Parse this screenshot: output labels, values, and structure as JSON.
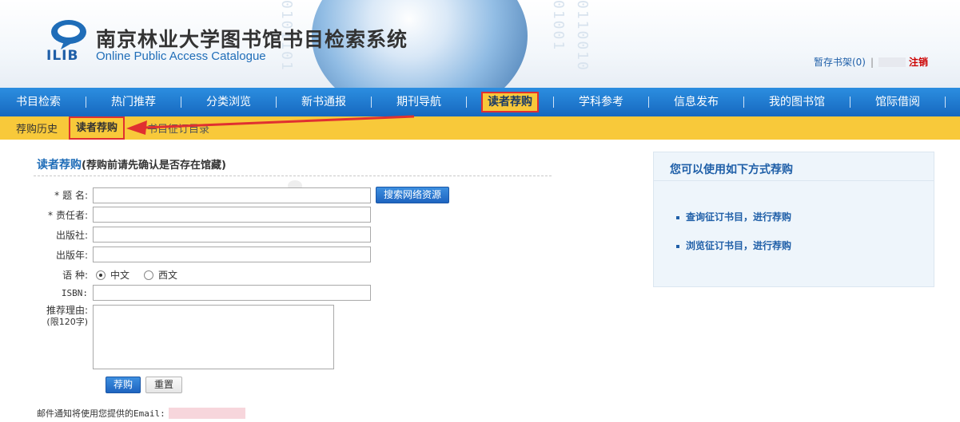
{
  "header": {
    "logo_text": "ILIB",
    "title": "南京林业大学图书馆书目检索系统",
    "subtitle": "Online Public Access Catalogue",
    "shelf_link": "暂存书架(0)",
    "separator": "|",
    "logout": "注销"
  },
  "nav": {
    "items": [
      {
        "label": "书目检索"
      },
      {
        "label": "热门推荐"
      },
      {
        "label": "分类浏览"
      },
      {
        "label": "新书通报"
      },
      {
        "label": "期刊导航"
      },
      {
        "label": "读者荐购"
      },
      {
        "label": "学科参考"
      },
      {
        "label": "信息发布"
      },
      {
        "label": "我的图书馆"
      },
      {
        "label": "馆际借阅"
      }
    ],
    "active_index": 5
  },
  "subnav": {
    "items": [
      {
        "label": "荐购历史"
      },
      {
        "label": "读者荐购"
      },
      {
        "label": "书目征订目录"
      }
    ],
    "active_index": 1
  },
  "form": {
    "title": "读者荐购",
    "title_note": "(荐购前请先确认是否存在馆藏)",
    "required_mark": "*",
    "fields": {
      "title_label": "题  名:",
      "author_label": "责任者:",
      "publisher_label": "出版社:",
      "year_label": "出版年:",
      "language_label": "语  种:",
      "isbn_label": "ISBN:",
      "reason_label": "推荐理由:",
      "reason_limit": "(限120字)"
    },
    "search_web_button": "搜索网络资源",
    "language_options": [
      {
        "label": "中文",
        "checked": true
      },
      {
        "label": "西文",
        "checked": false
      }
    ],
    "submit_button": "荐购",
    "reset_button": "重置",
    "email_note": "邮件通知将使用您提供的Email:"
  },
  "side": {
    "title": "您可以使用如下方式荐购",
    "links": [
      {
        "label": "查询征订书目，进行荐购"
      },
      {
        "label": "浏览征订书目，进行荐购"
      }
    ]
  },
  "colors": {
    "nav_blue": "#1f78d1",
    "subnav_yellow": "#f8c93a",
    "highlight_red": "#e03030",
    "link_blue": "#1f5fa8"
  }
}
